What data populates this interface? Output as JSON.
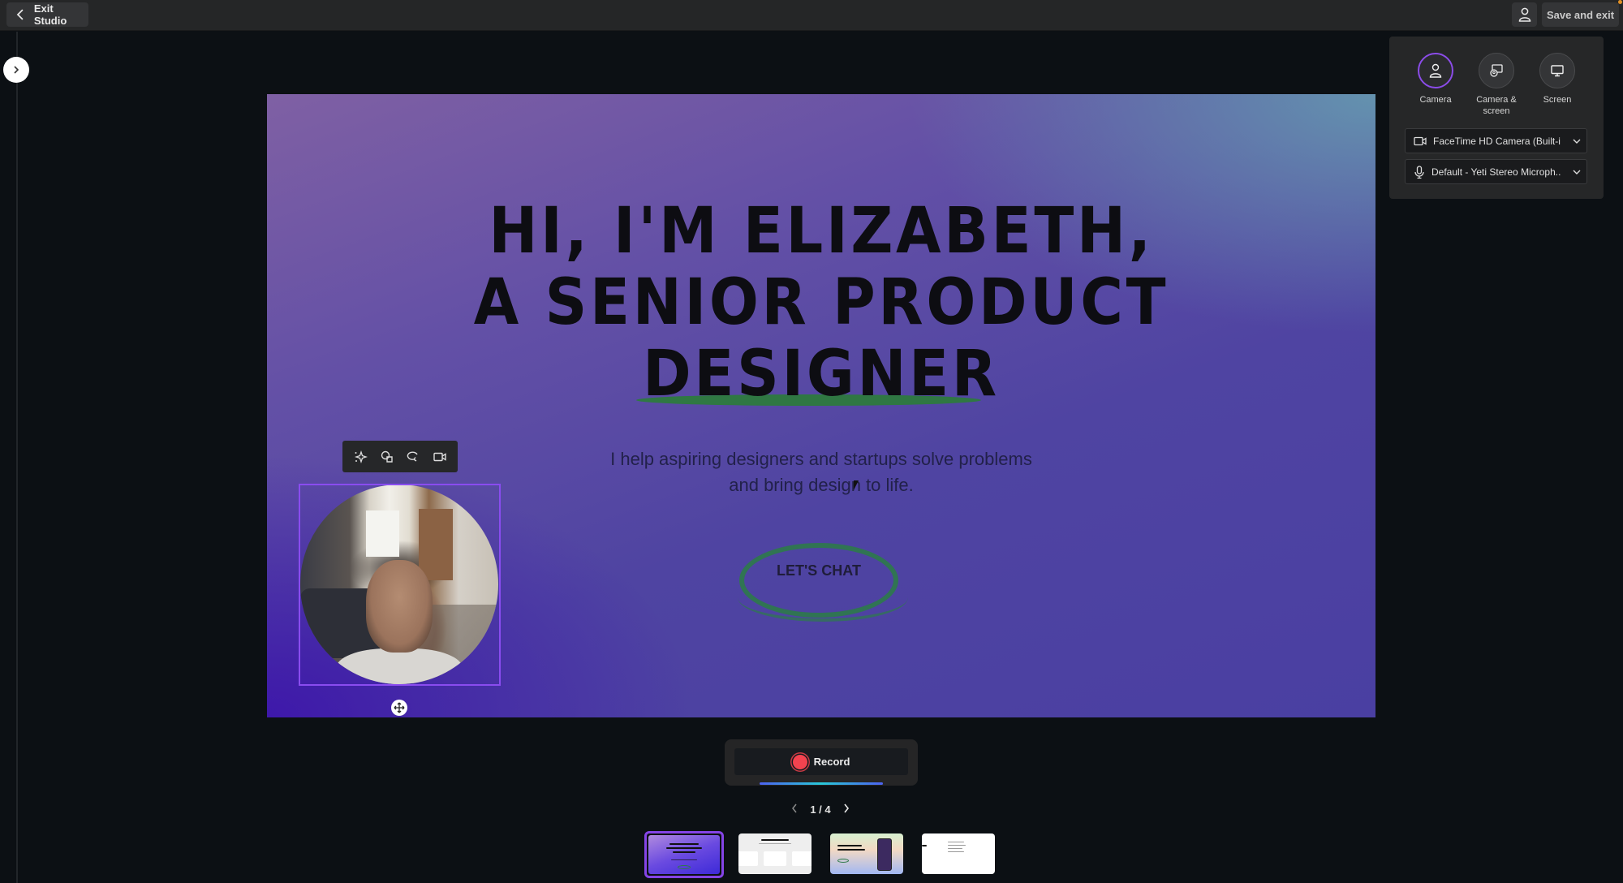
{
  "topbar": {
    "exit_label": "Exit Studio",
    "save_label": "Save and exit"
  },
  "slide": {
    "headline_lines": [
      "HI, I'M ELIZABETH,",
      "A SENIOR PRODUCT",
      "DESIGNER"
    ],
    "subtitle_lines": [
      "I help aspiring designers and startups solve problems",
      "and bring design to life."
    ],
    "cta_label": "LET'S CHAT"
  },
  "camera_toolbar": {
    "icons": [
      "sparkle-effects-icon",
      "shape-icon",
      "replace-icon",
      "camera-icon"
    ]
  },
  "panel": {
    "modes": [
      {
        "label": "Camera",
        "active": true
      },
      {
        "label": "Camera & screen",
        "active": false
      },
      {
        "label": "Screen",
        "active": false
      }
    ],
    "camera_device": "FaceTime HD Camera (Built-in...",
    "mic_device": "Default - Yeti Stereo Microph..."
  },
  "record": {
    "label": "Record",
    "page_current": 1,
    "page_total": 4,
    "page_text": "1 / 4"
  },
  "thumbnails": [
    {
      "title": "Hi, I'm Elizabeth slide",
      "active": true
    },
    {
      "title": "Who I work with slide",
      "active": false
    },
    {
      "title": "Your best way to support new artists slide",
      "active": false
    },
    {
      "title": "Contact slide",
      "active": false
    }
  ],
  "colors": {
    "accent_purple": "#8b4ce8",
    "record_red": "#f4434f",
    "green_stroke": "#2d7a3e",
    "notification": "#e39024"
  }
}
